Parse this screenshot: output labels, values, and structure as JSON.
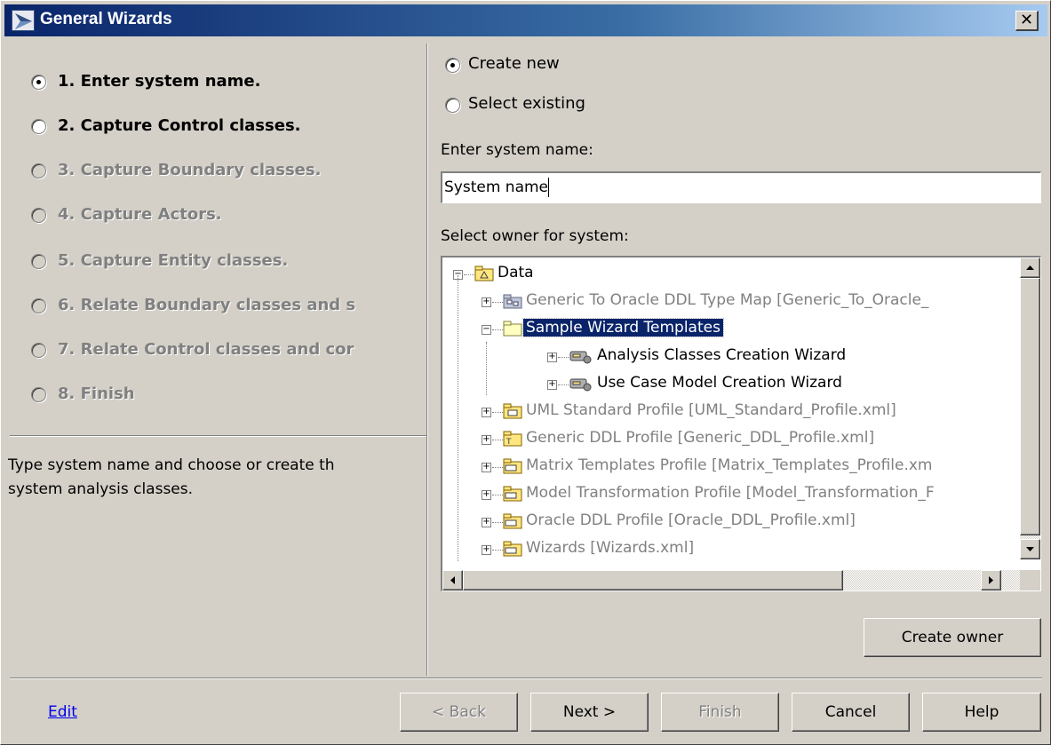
{
  "window": {
    "title": "General Wizards",
    "close_glyph": "✕"
  },
  "steps": [
    {
      "label": "1. Enter system name.",
      "state": "selected"
    },
    {
      "label": "2. Capture Control classes.",
      "state": "enabled"
    },
    {
      "label": "3. Capture Boundary classes.",
      "state": "disabled"
    },
    {
      "label": "4. Capture Actors.",
      "state": "disabled"
    },
    {
      "label": "5. Capture Entity classes.",
      "state": "disabled"
    },
    {
      "label": "6. Relate Boundary classes and s",
      "state": "disabled"
    },
    {
      "label": "7. Relate Control classes and cor",
      "state": "disabled"
    },
    {
      "label": "8. Finish",
      "state": "disabled"
    }
  ],
  "description": "Type system name and choose or create th\nsystem analysis classes.",
  "mode": {
    "create_new_label": "Create new",
    "select_existing_label": "Select existing",
    "selected": "create_new"
  },
  "system_name": {
    "label": "Enter system name:",
    "value": "System name"
  },
  "owner": {
    "label": "Select owner for system:",
    "tree": [
      {
        "label": "Data",
        "expander": "−",
        "icon": "package-root-icon",
        "gray": false
      },
      {
        "label": "Generic To Oracle DDL Type Map [Generic_To_Oracle_",
        "expander": "+",
        "icon": "type-map-icon",
        "gray": true
      },
      {
        "label": "Sample Wizard Templates",
        "expander": "−",
        "icon": "folder-icon",
        "gray": false,
        "selected": true
      },
      {
        "label": "Analysis Classes Creation Wizard",
        "expander": "+",
        "icon": "wizard-icon",
        "gray": false
      },
      {
        "label": "Use Case Model Creation Wizard",
        "expander": "+",
        "icon": "wizard-icon",
        "gray": false
      },
      {
        "label": "UML Standard Profile [UML_Standard_Profile.xml]",
        "expander": "+",
        "icon": "profile-icon",
        "gray": true
      },
      {
        "label": "Generic DDL Profile [Generic_DDL_Profile.xml]",
        "expander": "+",
        "icon": "ddl-profile-icon",
        "gray": true
      },
      {
        "label": "Matrix Templates Profile [Matrix_Templates_Profile.xm",
        "expander": "+",
        "icon": "stereotype-profile-icon",
        "gray": true
      },
      {
        "label": "Model Transformation Profile [Model_Transformation_F",
        "expander": "+",
        "icon": "stereotype-profile-icon",
        "gray": true
      },
      {
        "label": "Oracle DDL Profile [Oracle_DDL_Profile.xml]",
        "expander": "+",
        "icon": "stereotype-profile-icon",
        "gray": true
      },
      {
        "label": "Wizards [Wizards.xml]",
        "expander": "+",
        "icon": "stereotype-profile-icon",
        "gray": true
      }
    ],
    "create_owner_label": "Create owner"
  },
  "footer": {
    "edit_link": "Edit",
    "back_label": "< Back",
    "next_label": "Next >",
    "finish_label": "Finish",
    "cancel_label": "Cancel",
    "help_label": "Help"
  },
  "colors": {
    "title_gradient_start": "#0a246a",
    "title_gradient_end": "#a6caf0",
    "selection": "#0a246a",
    "dialog_bg": "#d4d0c8",
    "disabled_text": "#808080",
    "link": "#0000ee"
  }
}
